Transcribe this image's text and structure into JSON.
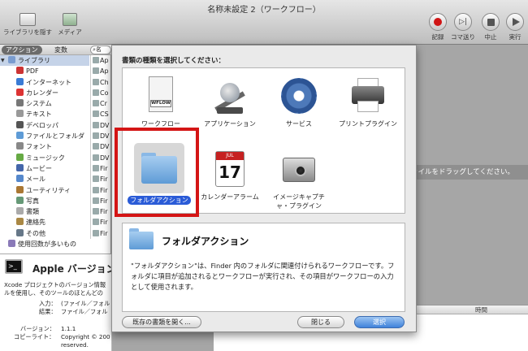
{
  "window": {
    "title": "名称未設定 2（ワークフロー）"
  },
  "toolbar": {
    "library_label": "ライブラリを隠す",
    "media_label": "メディア",
    "record_label": "記録",
    "step_label": "コマ送り",
    "stop_label": "中止",
    "run_label": "実行"
  },
  "left": {
    "tab_actions": "アクション",
    "tab_variables": "変数",
    "search_text": "名",
    "library_root": "ライブラリ",
    "library_items": [
      {
        "label": "PDF",
        "color": "#c33"
      },
      {
        "label": "インターネット",
        "color": "#3a7bd5"
      },
      {
        "label": "カレンダー",
        "color": "#d33"
      },
      {
        "label": "システム",
        "color": "#777"
      },
      {
        "label": "テキスト",
        "color": "#999"
      },
      {
        "label": "デベロッパ",
        "color": "#555"
      },
      {
        "label": "ファイルとフォルダ",
        "color": "#5e9bd6"
      },
      {
        "label": "フォント",
        "color": "#888"
      },
      {
        "label": "ミュージック",
        "color": "#6a4"
      },
      {
        "label": "ムービー",
        "color": "#46a"
      },
      {
        "label": "メール",
        "color": "#58c"
      },
      {
        "label": "ユーティリティ",
        "color": "#a73"
      },
      {
        "label": "写真",
        "color": "#697"
      },
      {
        "label": "書類",
        "color": "#aaa"
      },
      {
        "label": "連絡先",
        "color": "#a84"
      },
      {
        "label": "その他",
        "color": "#678"
      }
    ],
    "most_used": "使用回数が多いもの",
    "actions": [
      "Ap",
      "Ap",
      "Ch",
      "Co",
      "Cr",
      "CS",
      "DV",
      "DV",
      "DV",
      "DV",
      "Fir",
      "Fir",
      "Fir",
      "Fir",
      "Fir",
      "Fir",
      "Fir"
    ],
    "desc_title": "Apple バージョン",
    "desc_line1": "Xcode プロジェクトのバージョン情報",
    "desc_line2": "ルを使用し、そのツールのほとんどの",
    "input_key": "入力：",
    "input_val": "(ファイル／フォル",
    "result_key": "結果：",
    "result_val": "ファイル／フォル",
    "version_key": "バージョン：",
    "version_val": "1.1.1",
    "copyright_key": "コピーライト：",
    "copyright_val1": "Copyright © 200",
    "copyright_val2": "reserved."
  },
  "right": {
    "drop_hint": "ァイルをドラッグしてください。",
    "log_col_time": "時間"
  },
  "dialog": {
    "prompt": "書類の種類を選択してください：",
    "items": [
      {
        "label": "ワークフロー",
        "icon": "workflow-icon"
      },
      {
        "label": "アプリケーション",
        "icon": "automator-robot-icon"
      },
      {
        "label": "サービス",
        "icon": "gear-icon"
      },
      {
        "label": "プリントプラグイン",
        "icon": "printer-icon"
      },
      {
        "label": "フォルダアクション",
        "icon": "folder-icon"
      },
      {
        "label": "カレンダーアラーム",
        "icon": "calendar-icon"
      },
      {
        "label": "イメージキャプチャ・プラグイン",
        "icon": "camera-icon"
      }
    ],
    "workflow_tag": "WFLOW",
    "cal_month": "JUL",
    "cal_day": "17",
    "selected_title": "フォルダアクション",
    "selected_desc": "\"フォルダアクション\"は、Finder 内のフォルダに関連付けられるワークフローです。フォルダに項目が追加されるとワークフローが実行され、その項目がワークフローの入力として使用されます。",
    "open_existing": "既存の書類を開く...",
    "close": "閉じる",
    "choose": "選択"
  },
  "colors": {
    "accent": "#2a5bd7",
    "highlight": "#d41515",
    "record": "#d01515"
  }
}
